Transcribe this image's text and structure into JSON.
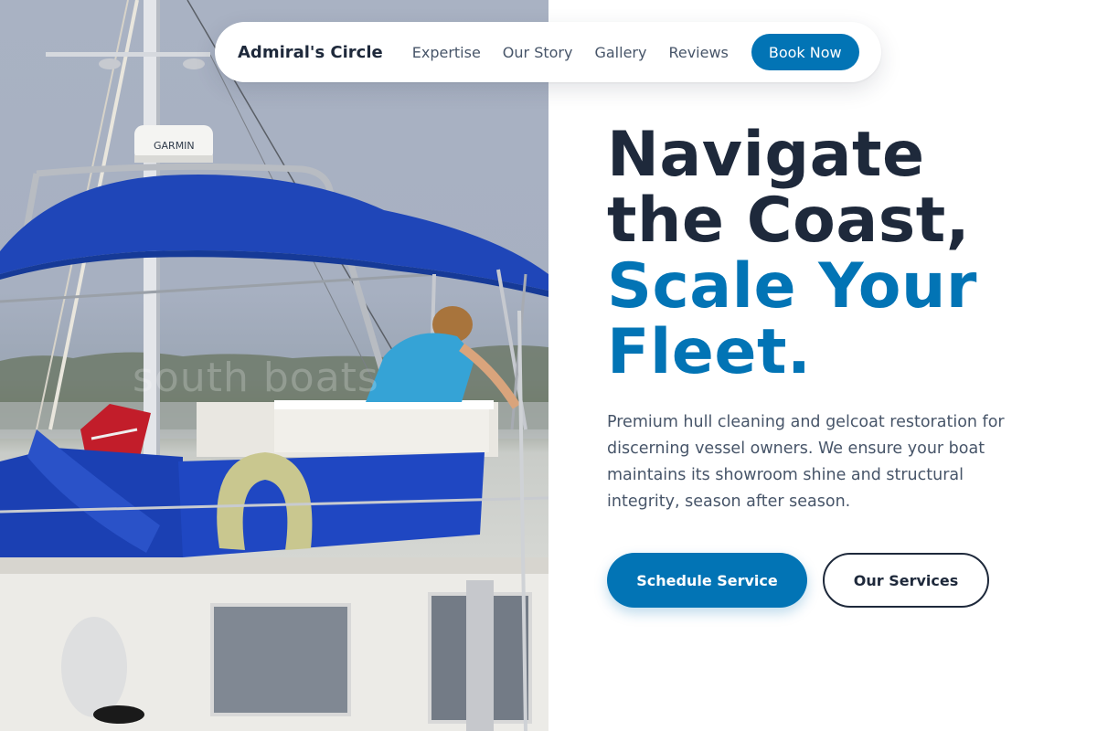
{
  "nav": {
    "brand": "Admiral's Circle",
    "links": [
      "Expertise",
      "Our Story",
      "Gallery",
      "Reviews"
    ],
    "cta": "Book Now"
  },
  "hero": {
    "headline_line1": "Navigate",
    "headline_line2": "the Coast,",
    "headline_accent_line1": "Scale Your",
    "headline_accent_line2": "Fleet.",
    "description": "Premium hull cleaning and gelcoat restoration for discerning vessel owners. We ensure your boat maintains its showroom shine and structural integrity, season after season.",
    "primary_cta": "Schedule Service",
    "secondary_cta": "Our Services"
  },
  "photo": {
    "watermark": "south boats",
    "radar_text": "GARMIN"
  },
  "colors": {
    "accent": "#0274b5",
    "heading": "#1e293b",
    "body_text": "#475569",
    "bimini_blue": "#1f46b8"
  }
}
